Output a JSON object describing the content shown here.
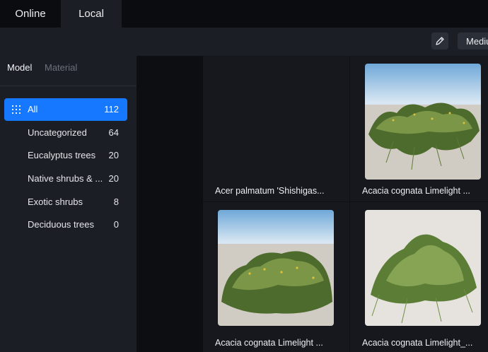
{
  "tabs": {
    "online": "Online",
    "local": "Local"
  },
  "toolbar": {
    "size_label": "Medium",
    "edit_icon": "pencil-icon"
  },
  "sidebar": {
    "sub_tabs": {
      "model": "Model",
      "material": "Material"
    },
    "categories": [
      {
        "label": "All",
        "count": "112",
        "active": true
      },
      {
        "label": "Uncategorized",
        "count": "64"
      },
      {
        "label": "Eucalyptus trees",
        "count": "20"
      },
      {
        "label": "Native shrubs & ...",
        "count": "20"
      },
      {
        "label": "Exotic shrubs",
        "count": "8"
      },
      {
        "label": "Deciduous trees",
        "count": "0"
      }
    ]
  },
  "assets": [
    {
      "title": "Acer palmatum 'Shishigas...",
      "thumbnail": "none"
    },
    {
      "title": "Acacia cognata Limelight ...",
      "thumbnail": "shrub-render-sky"
    },
    {
      "title": "Acacia cognata Limelight ...",
      "thumbnail": "shrub-render-sky"
    },
    {
      "title": "Acacia cognata Limelight_...",
      "thumbnail": "shrub-render-studio"
    }
  ],
  "colors": {
    "accent": "#1677ff",
    "background": "#14161b",
    "sidebar": "#1b1e24"
  }
}
